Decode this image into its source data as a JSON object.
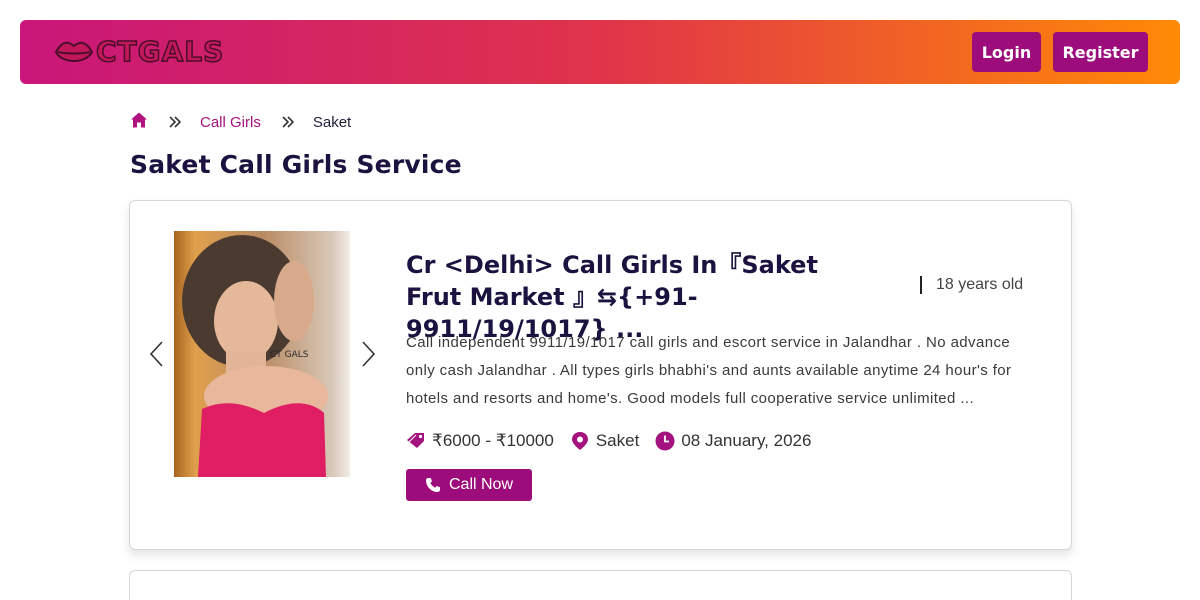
{
  "header": {
    "logo_text": "CTGALS",
    "login_label": "Login",
    "register_label": "Register"
  },
  "breadcrumb": {
    "items": [
      {
        "label": "Call Girls"
      },
      {
        "label": "Saket"
      }
    ]
  },
  "page": {
    "title": "Saket Call Girls Service"
  },
  "listings": [
    {
      "title": "Cr <Delhi> Call Girls In『Saket Frut Market 』⇆{+91-9911/19/1017} ...",
      "age": "18 years old",
      "description": "Call independent 9911/19/1017 call girls and escort service in Jalandhar . No advance only cash Jalandhar . All types girls bhabhi's and aunts available anytime 24 hour's for hotels and resorts and home's. Good models full cooperative service unlimited ...",
      "price": "₹6000 - ₹10000",
      "location": "Saket",
      "date": "08 January, 2026",
      "call_label": "Call Now",
      "photo_watermark": "CT GALS"
    }
  ],
  "colors": {
    "brand": "#9c0c7b",
    "header_gradient_start": "#c8167a",
    "header_gradient_end": "#ff8a05",
    "title": "#1c1240"
  },
  "icons": {
    "home": "home-icon",
    "separator": "double-chevron-right-icon",
    "price": "price-tag-icon",
    "location": "location-pin-icon",
    "date": "clock-icon",
    "phone": "phone-icon",
    "prev": "chevron-left-icon",
    "next": "chevron-right-icon"
  }
}
